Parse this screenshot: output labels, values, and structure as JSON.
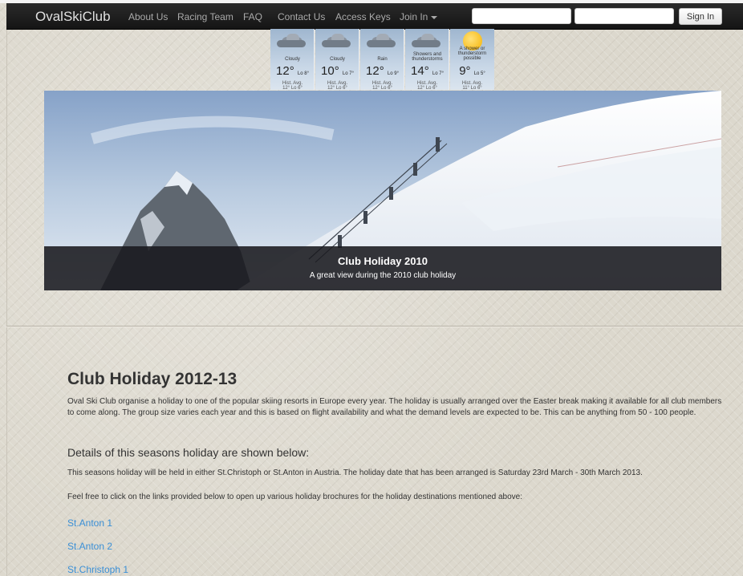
{
  "navbar": {
    "brand": "OvalSkiClub",
    "items": [
      "About Us",
      "Racing Team",
      "FAQ",
      "Contact Us",
      "Access Keys"
    ],
    "join": "Join In",
    "signin": "Sign In"
  },
  "weather": [
    {
      "cond": "Cloudy",
      "hi": "12°",
      "lo": "Lo 8°",
      "hist_label": "Hist. Avg.",
      "hist": "12° Lo 6°",
      "icon": "cloud-icon"
    },
    {
      "cond": "Cloudy",
      "hi": "10°",
      "lo": "Lo 7°",
      "hist_label": "Hist. Avg.",
      "hist": "12° Lo 6°",
      "icon": "cloud-icon"
    },
    {
      "cond": "Rain",
      "hi": "12°",
      "lo": "Lo 9°",
      "hist_label": "Hist. Avg.",
      "hist": "12° Lo 6°",
      "icon": "rain-cloud-icon"
    },
    {
      "cond": "Showers and thunderstorms",
      "hi": "14°",
      "lo": "Lo 7°",
      "hist_label": "Hist. Avg.",
      "hist": "12° Lo 6°",
      "icon": "storm-cloud-icon"
    },
    {
      "cond": "A shower or thunderstorm possible",
      "hi": "9°",
      "lo": "Lo 5°",
      "hist_label": "Hist. Avg.",
      "hist": "11° Lo 6°",
      "icon": "sun-cloud-icon"
    }
  ],
  "hero": {
    "title": "Club Holiday 2010",
    "text": "A great view during the 2010 club holiday"
  },
  "main": {
    "heading": "Club Holiday 2012-13",
    "intro": "Oval Ski Club organise a holiday to one of the popular skiing resorts in Europe every year. The holiday is usually arranged over the Easter break making it available for all club members to come along. The group size varies each year and this is based on flight availability and what the demand levels are expected to be. This can be anything from 50 - 100 people.",
    "subheading": "Details of this seasons holiday are shown below:",
    "details": "This seasons holiday will be held in either St.Christoph or St.Anton in Austria. The holiday date that has been arranged is Saturday 23rd March - 30th March 2013.",
    "links_intro": "Feel free to click on the links provided below to open up various holiday brochures for the holiday destinations mentioned above:",
    "links": [
      "St.Anton 1",
      "St.Anton 2",
      "St.Christoph 1"
    ]
  },
  "colors": {
    "navbar": "#1c1c1c",
    "link": "#3a8fd6",
    "caption_bg": "#19191e"
  }
}
